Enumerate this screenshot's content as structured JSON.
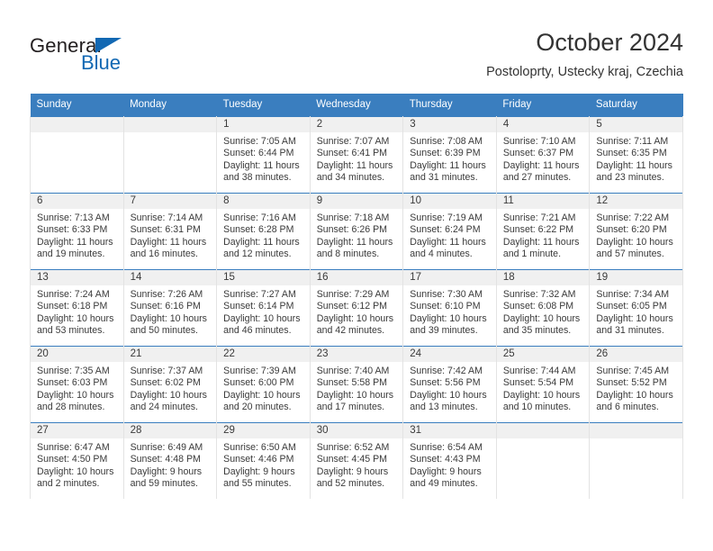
{
  "brand": {
    "name_part1": "General",
    "name_part2": "Blue",
    "accent_color": "#1268b3"
  },
  "header": {
    "title": "October 2024",
    "subtitle": "Postoloprty, Ustecky kraj, Czechia"
  },
  "calendar": {
    "header_color": "#3a7ebf",
    "weekday_headers": [
      "Sunday",
      "Monday",
      "Tuesday",
      "Wednesday",
      "Thursday",
      "Friday",
      "Saturday"
    ],
    "weeks": [
      [
        {
          "day": "",
          "sunrise": "",
          "sunset": "",
          "daylight": "",
          "empty": true
        },
        {
          "day": "",
          "sunrise": "",
          "sunset": "",
          "daylight": "",
          "empty": true
        },
        {
          "day": "1",
          "sunrise": "Sunrise: 7:05 AM",
          "sunset": "Sunset: 6:44 PM",
          "daylight": "Daylight: 11 hours and 38 minutes.",
          "empty": false
        },
        {
          "day": "2",
          "sunrise": "Sunrise: 7:07 AM",
          "sunset": "Sunset: 6:41 PM",
          "daylight": "Daylight: 11 hours and 34 minutes.",
          "empty": false
        },
        {
          "day": "3",
          "sunrise": "Sunrise: 7:08 AM",
          "sunset": "Sunset: 6:39 PM",
          "daylight": "Daylight: 11 hours and 31 minutes.",
          "empty": false
        },
        {
          "day": "4",
          "sunrise": "Sunrise: 7:10 AM",
          "sunset": "Sunset: 6:37 PM",
          "daylight": "Daylight: 11 hours and 27 minutes.",
          "empty": false
        },
        {
          "day": "5",
          "sunrise": "Sunrise: 7:11 AM",
          "sunset": "Sunset: 6:35 PM",
          "daylight": "Daylight: 11 hours and 23 minutes.",
          "empty": false
        }
      ],
      [
        {
          "day": "6",
          "sunrise": "Sunrise: 7:13 AM",
          "sunset": "Sunset: 6:33 PM",
          "daylight": "Daylight: 11 hours and 19 minutes.",
          "empty": false
        },
        {
          "day": "7",
          "sunrise": "Sunrise: 7:14 AM",
          "sunset": "Sunset: 6:31 PM",
          "daylight": "Daylight: 11 hours and 16 minutes.",
          "empty": false
        },
        {
          "day": "8",
          "sunrise": "Sunrise: 7:16 AM",
          "sunset": "Sunset: 6:28 PM",
          "daylight": "Daylight: 11 hours and 12 minutes.",
          "empty": false
        },
        {
          "day": "9",
          "sunrise": "Sunrise: 7:18 AM",
          "sunset": "Sunset: 6:26 PM",
          "daylight": "Daylight: 11 hours and 8 minutes.",
          "empty": false
        },
        {
          "day": "10",
          "sunrise": "Sunrise: 7:19 AM",
          "sunset": "Sunset: 6:24 PM",
          "daylight": "Daylight: 11 hours and 4 minutes.",
          "empty": false
        },
        {
          "day": "11",
          "sunrise": "Sunrise: 7:21 AM",
          "sunset": "Sunset: 6:22 PM",
          "daylight": "Daylight: 11 hours and 1 minute.",
          "empty": false
        },
        {
          "day": "12",
          "sunrise": "Sunrise: 7:22 AM",
          "sunset": "Sunset: 6:20 PM",
          "daylight": "Daylight: 10 hours and 57 minutes.",
          "empty": false
        }
      ],
      [
        {
          "day": "13",
          "sunrise": "Sunrise: 7:24 AM",
          "sunset": "Sunset: 6:18 PM",
          "daylight": "Daylight: 10 hours and 53 minutes.",
          "empty": false
        },
        {
          "day": "14",
          "sunrise": "Sunrise: 7:26 AM",
          "sunset": "Sunset: 6:16 PM",
          "daylight": "Daylight: 10 hours and 50 minutes.",
          "empty": false
        },
        {
          "day": "15",
          "sunrise": "Sunrise: 7:27 AM",
          "sunset": "Sunset: 6:14 PM",
          "daylight": "Daylight: 10 hours and 46 minutes.",
          "empty": false
        },
        {
          "day": "16",
          "sunrise": "Sunrise: 7:29 AM",
          "sunset": "Sunset: 6:12 PM",
          "daylight": "Daylight: 10 hours and 42 minutes.",
          "empty": false
        },
        {
          "day": "17",
          "sunrise": "Sunrise: 7:30 AM",
          "sunset": "Sunset: 6:10 PM",
          "daylight": "Daylight: 10 hours and 39 minutes.",
          "empty": false
        },
        {
          "day": "18",
          "sunrise": "Sunrise: 7:32 AM",
          "sunset": "Sunset: 6:08 PM",
          "daylight": "Daylight: 10 hours and 35 minutes.",
          "empty": false
        },
        {
          "day": "19",
          "sunrise": "Sunrise: 7:34 AM",
          "sunset": "Sunset: 6:05 PM",
          "daylight": "Daylight: 10 hours and 31 minutes.",
          "empty": false
        }
      ],
      [
        {
          "day": "20",
          "sunrise": "Sunrise: 7:35 AM",
          "sunset": "Sunset: 6:03 PM",
          "daylight": "Daylight: 10 hours and 28 minutes.",
          "empty": false
        },
        {
          "day": "21",
          "sunrise": "Sunrise: 7:37 AM",
          "sunset": "Sunset: 6:02 PM",
          "daylight": "Daylight: 10 hours and 24 minutes.",
          "empty": false
        },
        {
          "day": "22",
          "sunrise": "Sunrise: 7:39 AM",
          "sunset": "Sunset: 6:00 PM",
          "daylight": "Daylight: 10 hours and 20 minutes.",
          "empty": false
        },
        {
          "day": "23",
          "sunrise": "Sunrise: 7:40 AM",
          "sunset": "Sunset: 5:58 PM",
          "daylight": "Daylight: 10 hours and 17 minutes.",
          "empty": false
        },
        {
          "day": "24",
          "sunrise": "Sunrise: 7:42 AM",
          "sunset": "Sunset: 5:56 PM",
          "daylight": "Daylight: 10 hours and 13 minutes.",
          "empty": false
        },
        {
          "day": "25",
          "sunrise": "Sunrise: 7:44 AM",
          "sunset": "Sunset: 5:54 PM",
          "daylight": "Daylight: 10 hours and 10 minutes.",
          "empty": false
        },
        {
          "day": "26",
          "sunrise": "Sunrise: 7:45 AM",
          "sunset": "Sunset: 5:52 PM",
          "daylight": "Daylight: 10 hours and 6 minutes.",
          "empty": false
        }
      ],
      [
        {
          "day": "27",
          "sunrise": "Sunrise: 6:47 AM",
          "sunset": "Sunset: 4:50 PM",
          "daylight": "Daylight: 10 hours and 2 minutes.",
          "empty": false
        },
        {
          "day": "28",
          "sunrise": "Sunrise: 6:49 AM",
          "sunset": "Sunset: 4:48 PM",
          "daylight": "Daylight: 9 hours and 59 minutes.",
          "empty": false
        },
        {
          "day": "29",
          "sunrise": "Sunrise: 6:50 AM",
          "sunset": "Sunset: 4:46 PM",
          "daylight": "Daylight: 9 hours and 55 minutes.",
          "empty": false
        },
        {
          "day": "30",
          "sunrise": "Sunrise: 6:52 AM",
          "sunset": "Sunset: 4:45 PM",
          "daylight": "Daylight: 9 hours and 52 minutes.",
          "empty": false
        },
        {
          "day": "31",
          "sunrise": "Sunrise: 6:54 AM",
          "sunset": "Sunset: 4:43 PM",
          "daylight": "Daylight: 9 hours and 49 minutes.",
          "empty": false
        },
        {
          "day": "",
          "sunrise": "",
          "sunset": "",
          "daylight": "",
          "empty": true
        },
        {
          "day": "",
          "sunrise": "",
          "sunset": "",
          "daylight": "",
          "empty": true
        }
      ]
    ]
  }
}
